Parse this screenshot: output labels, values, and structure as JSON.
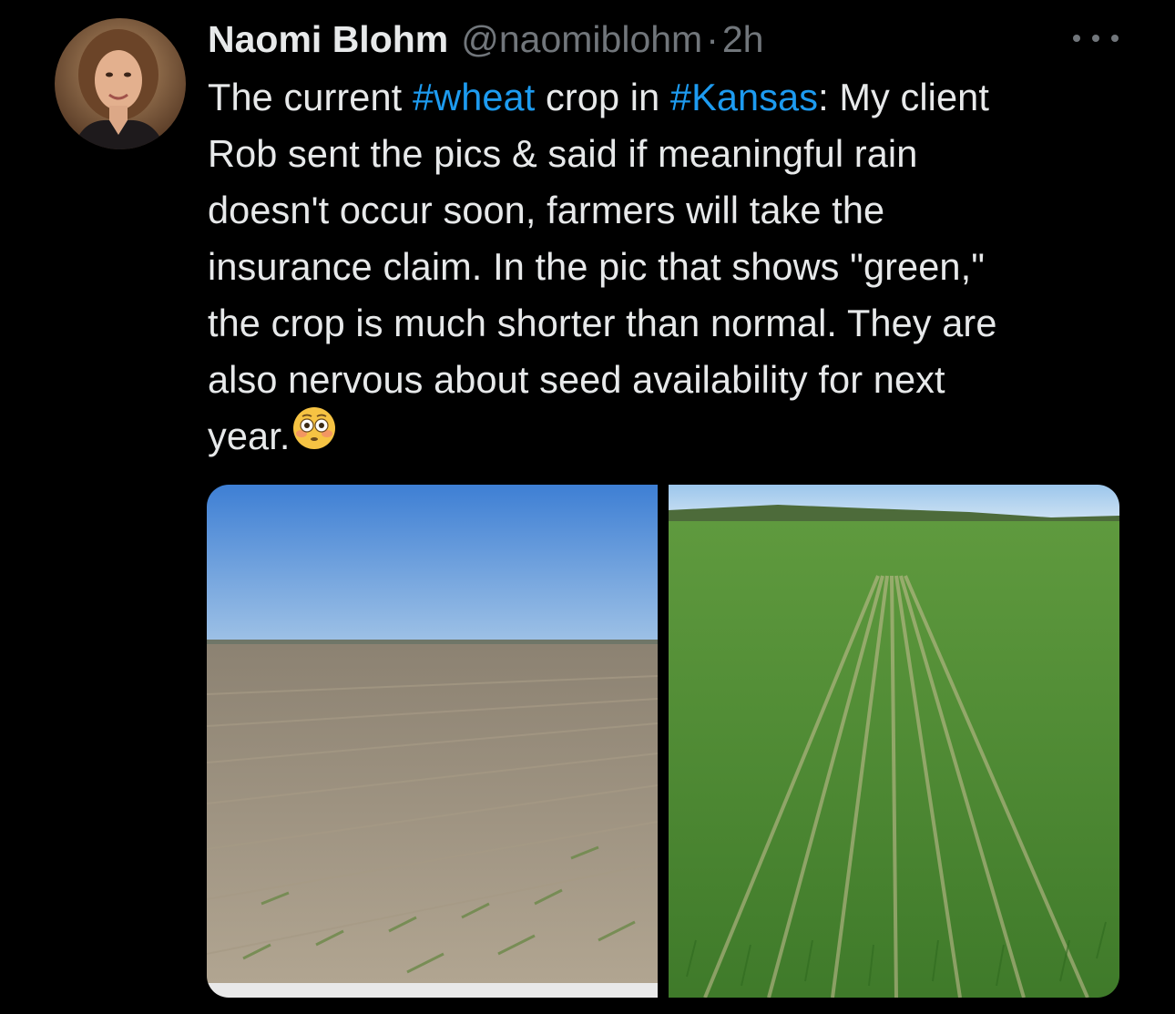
{
  "author": {
    "display_name": "Naomi Blohm",
    "handle": "@naomiblohm",
    "separator": "·",
    "time": "2h",
    "avatar_icon": "profile-photo"
  },
  "more_icon": "more-options-icon",
  "text": {
    "line1": {
      "a": "The current ",
      "hashtag1": "#wheat",
      "b": " crop in ",
      "hashtag2": "#Kansas",
      "c": ": My client"
    },
    "line2": "Rob sent the pics & said if meaningful rain",
    "line3": "doesn't occur soon, farmers will take the",
    "line4": "insurance claim. In the pic that shows \"green,\"",
    "line5": "the crop is much shorter than normal. They are",
    "line6": "also nervous about seed availability for next",
    "line7": "year.",
    "emoji": "flushed-face-emoji"
  },
  "colors": {
    "background": "#000000",
    "text": "#e7e9ea",
    "secondary": "#71767b",
    "link": "#1d9bf0"
  },
  "media": [
    {
      "name": "dry-wheat-field-photo"
    },
    {
      "name": "green-wheat-field-photo"
    }
  ]
}
